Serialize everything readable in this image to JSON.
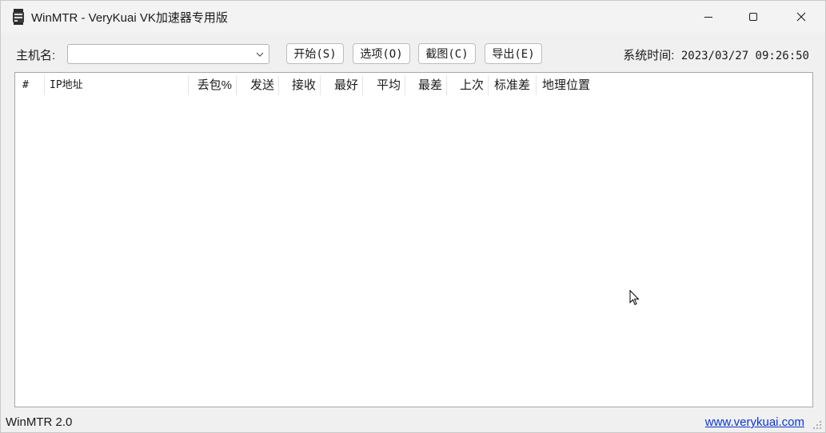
{
  "window": {
    "title": "WinMTR - VeryKuai VK加速器专用版",
    "icons": {
      "app": "winmtr-app-icon",
      "minimize": "minimize-icon",
      "maximize": "maximize-icon",
      "close": "close-icon"
    }
  },
  "toolbar": {
    "host_label": "主机名:",
    "host_value": "",
    "host_placeholder": "",
    "start_label": "开始(S)",
    "options_label": "选项(O)",
    "capture_label": "截图(C)",
    "export_label": "导出(E)",
    "time_label": "系统时间:",
    "time_value": "2023/03/27 09:26:50"
  },
  "table": {
    "columns": [
      "#",
      "IP地址",
      "丢包%",
      "发送",
      "接收",
      "最好",
      "平均",
      "最差",
      "上次",
      "标准差",
      "地理位置"
    ],
    "rows": []
  },
  "status": {
    "version": "WinMTR 2.0",
    "link": "www.verykuai.com"
  },
  "colors": {
    "link": "#0a36d6",
    "window_bg": "#f0f0f0"
  }
}
